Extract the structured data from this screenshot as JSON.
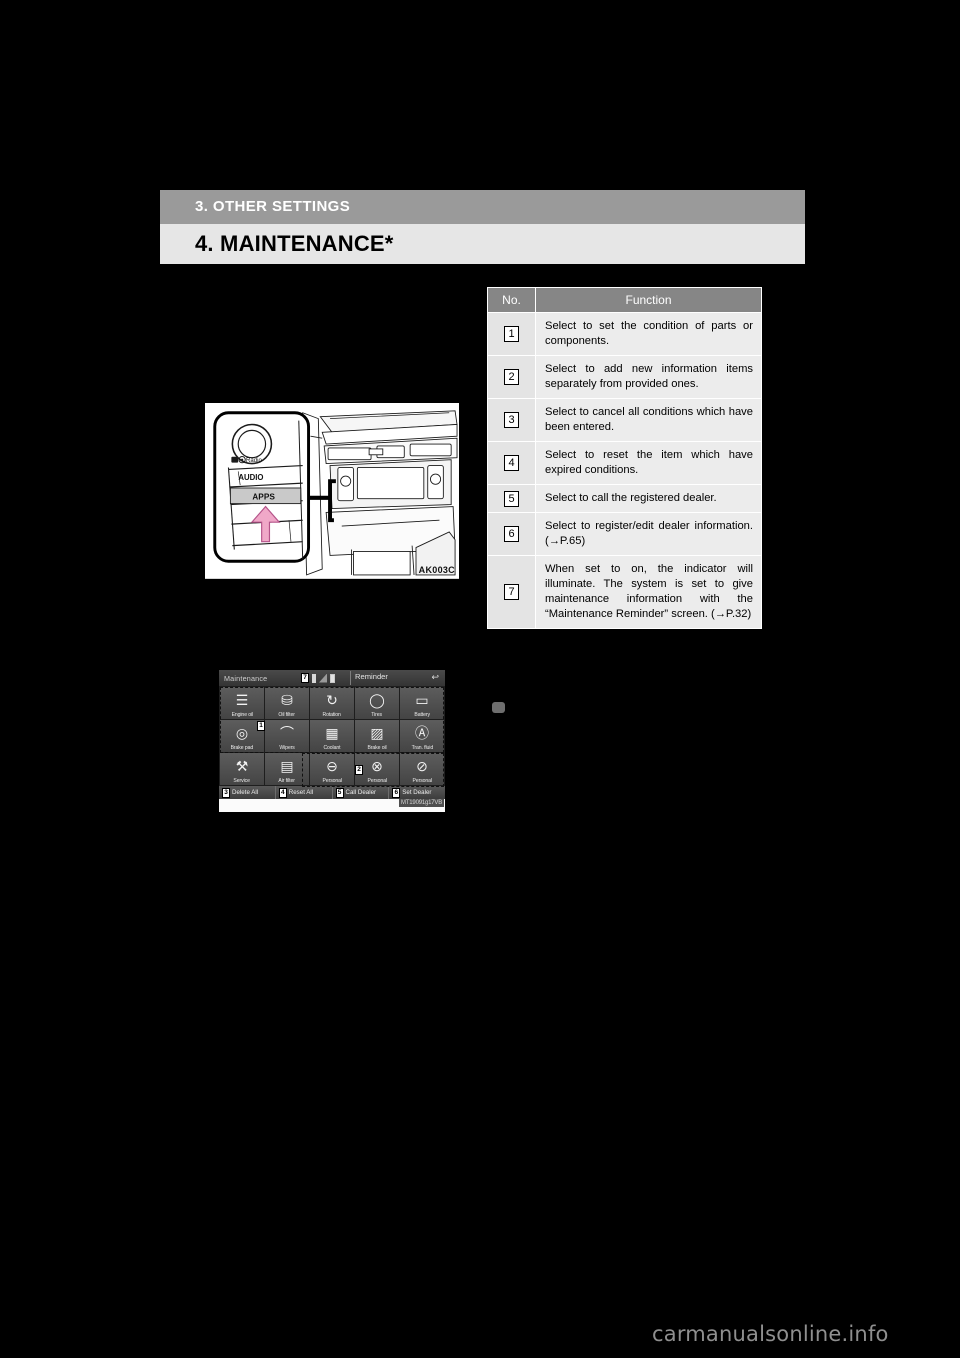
{
  "header": {
    "chapter": "3. OTHER SETTINGS",
    "section": "4. MAINTENANCE*"
  },
  "table": {
    "columns": {
      "no": "No.",
      "function": "Function"
    },
    "rows": [
      {
        "no": "1",
        "text": "Select to set the condition of parts or components."
      },
      {
        "no": "2",
        "text": "Select to add new information items separately from provided ones."
      },
      {
        "no": "3",
        "text": "Select to cancel all conditions which have been entered."
      },
      {
        "no": "4",
        "text": "Select to reset the item which have expired conditions."
      },
      {
        "no": "5",
        "text": "Select to call the registered dealer."
      },
      {
        "no": "6",
        "text": "Select to register/edit dealer information. (→P.65)"
      },
      {
        "no": "7",
        "text": "When set to on, the indicator will illuminate. The system is set to give maintenance information with the “Maintenance Reminder” screen. (→P.32)"
      }
    ]
  },
  "figure_dash": {
    "code": "AK003C",
    "labels": {
      "hd_radio": "Radio",
      "audio": "AUDIO",
      "apps": "APPS"
    }
  },
  "figure_screen": {
    "title": "Maintenance",
    "reminder_label": "Reminder",
    "status_callout": "7",
    "icons": {
      "bluetooth": "bluetooth-icon",
      "signal": "signal-icon",
      "battery": "battery-icon",
      "back": "back-arrow-icon"
    },
    "grid": [
      {
        "label": "Engine oil",
        "glyph": "☰"
      },
      {
        "label": "Oil filter",
        "glyph": "⛁"
      },
      {
        "label": "Rotation",
        "glyph": "↻"
      },
      {
        "label": "Tires",
        "glyph": "◯"
      },
      {
        "label": "Battery",
        "glyph": "▭"
      },
      {
        "label": "Brake pad",
        "glyph": "◎"
      },
      {
        "label": "Wipers",
        "glyph": "⌒"
      },
      {
        "label": "Coolant",
        "glyph": "▦"
      },
      {
        "label": "Brake oil",
        "glyph": "▨"
      },
      {
        "label": "Tran. fluid",
        "glyph": "Ⓐ"
      },
      {
        "label": "Service",
        "glyph": "⚒"
      },
      {
        "label": "Air filter",
        "glyph": "▤"
      },
      {
        "label": "Personal",
        "glyph": "⊖"
      },
      {
        "label": "Personal",
        "glyph": "⊗"
      },
      {
        "label": "Personal",
        "glyph": "⊘"
      }
    ],
    "bottom_buttons": [
      {
        "no": "3",
        "label": "Delete All"
      },
      {
        "no": "4",
        "label": "Reset All"
      },
      {
        "no": "5",
        "label": "Call Dealer"
      },
      {
        "no": "6",
        "label": "Set Dealer"
      }
    ],
    "callouts": {
      "group1": "1",
      "group2": "2"
    },
    "code": "MT19091g17VB"
  },
  "watermark": "carmanualsonline.info"
}
